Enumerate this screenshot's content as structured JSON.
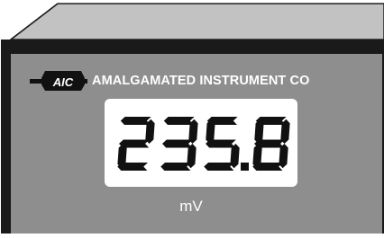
{
  "panel_meter": {
    "brand_name": "AMALGAMATED INSTRUMENT CO",
    "logo_text": "AIC",
    "display": {
      "reading": "235.8",
      "digits": [
        "2",
        "3",
        "5",
        "8"
      ],
      "decimal_after_index": 2
    },
    "unit": "mV",
    "colors": {
      "bezel": "#1a1a1a",
      "face": "#8e8e8e",
      "housing_top": "#c2c2c2",
      "display_window": "#ffffff",
      "segments": "#111111",
      "text": "#ffffff"
    }
  }
}
